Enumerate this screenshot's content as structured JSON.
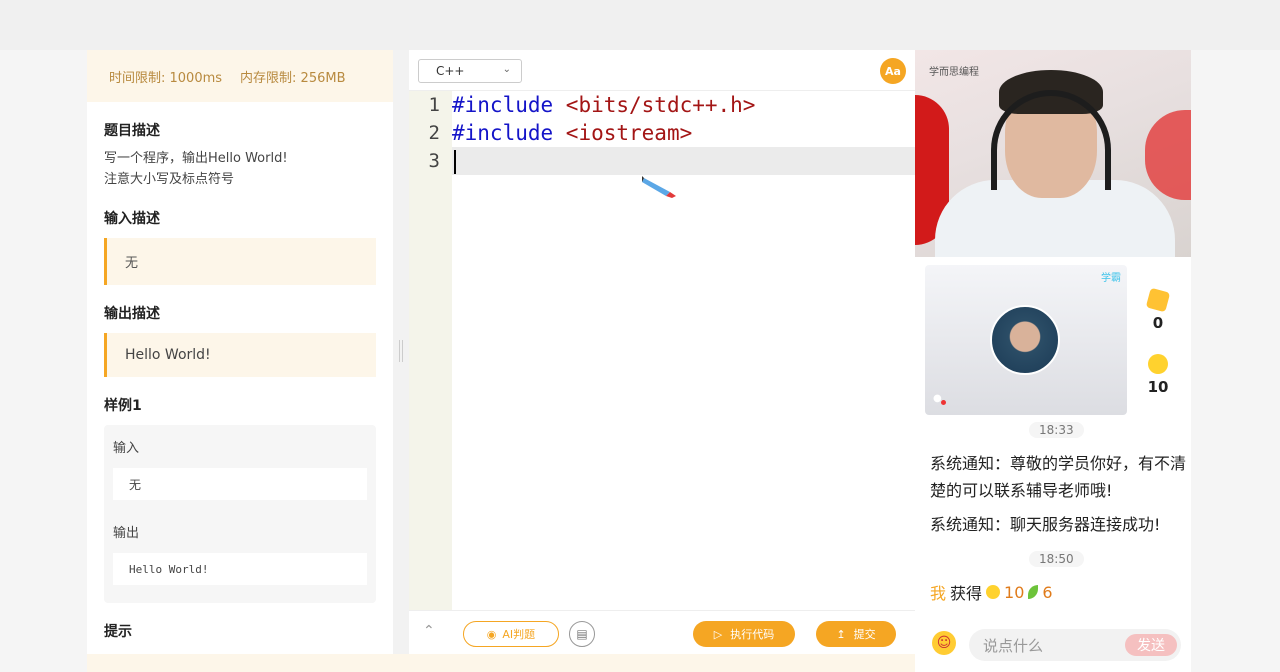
{
  "problem": {
    "time_limit": "时间限制: 1000ms",
    "memory_limit": "内存限制: 256MB",
    "desc_title": "题目描述",
    "desc_lines": [
      "写一个程序，输出Hello World!",
      "注意大小写及标点符号"
    ],
    "input_title": "输入描述",
    "input_value": "无",
    "output_title": "输出描述",
    "output_value": "Hello World!",
    "sample_title": "样例1",
    "sample_input_label": "输入",
    "sample_input": "无",
    "sample_output_label": "输出",
    "sample_output": "Hello World!",
    "hint_title": "提示"
  },
  "editor": {
    "language": "C++",
    "font_button": "Aa",
    "lines": [
      {
        "num": "1",
        "kw": "#include",
        "str": " <bits/stdc++.h>"
      },
      {
        "num": "2",
        "kw": "#include",
        "str": " <iostream>"
      },
      {
        "num": "3",
        "kw": "",
        "str": ""
      }
    ],
    "ai_judge": "AI判题",
    "run": "执行代码",
    "submit": "提交"
  },
  "live": {
    "logo": "学而思编程",
    "mini_tag": "学霸",
    "cards": "0",
    "coins": "10",
    "time1": "18:33",
    "msg1": "系统通知：尊敬的学员你好，有不清楚的可以联系辅导老师哦!",
    "msg2": "系统通知：聊天服务器连接成功!",
    "time2": "18:50",
    "reward_me": "我",
    "reward_text": "获得",
    "reward_coin": "10",
    "reward_leaf": "6",
    "chat_placeholder": "说点什么",
    "send": "发送"
  }
}
